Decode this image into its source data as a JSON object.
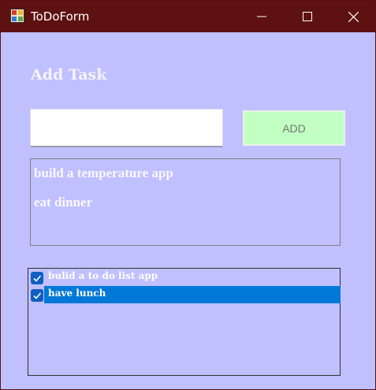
{
  "window": {
    "title": "ToDoForm",
    "icon": "form-app-icon"
  },
  "colors": {
    "titlebar": "#5e1111",
    "background": "#c0c0ff",
    "add_button": "#c2ffc2",
    "selection": "#0078d7"
  },
  "heading": "Add Task",
  "input": {
    "value": "",
    "placeholder": ""
  },
  "add_button_label": "ADD",
  "tasks": [
    {
      "label": "build a temperature app"
    },
    {
      "label": "eat dinner"
    }
  ],
  "completed": [
    {
      "label": "bulid a to do list app",
      "checked": true,
      "selected": false
    },
    {
      "label": "have lunch",
      "checked": true,
      "selected": true
    }
  ]
}
